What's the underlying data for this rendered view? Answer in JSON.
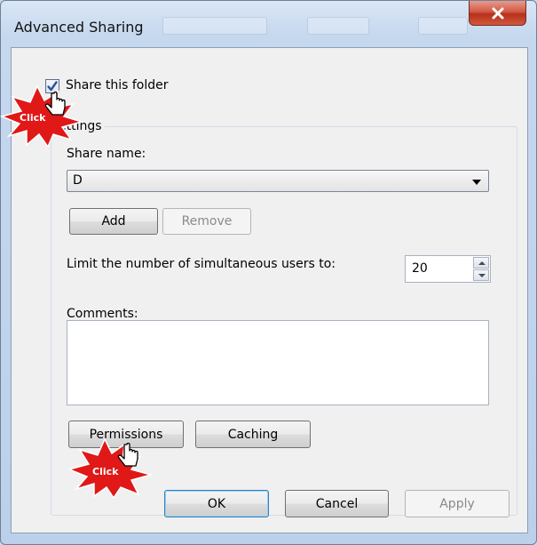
{
  "window": {
    "title": "Advanced Sharing"
  },
  "share": {
    "checkbox_label": "Share this folder",
    "checked": true
  },
  "settings": {
    "group_title": "ettings",
    "share_name_label": "Share name:",
    "share_name_value": "D",
    "add_label": "Add",
    "remove_label": "Remove",
    "limit_label": "Limit the number of simultaneous users to:",
    "limit_value": "20",
    "comments_label": "Comments:",
    "comments_value": "",
    "permissions_label": "Permissions",
    "caching_label": "Caching"
  },
  "footer": {
    "ok_label": "OK",
    "cancel_label": "Cancel",
    "apply_label": "Apply"
  },
  "annotations": {
    "click_label_1": "Click",
    "click_label_2": "Click",
    "burst_color": "#e01818"
  },
  "icons": {
    "close": "close-x-icon",
    "checkmark": "checkmark-icon",
    "combo_arrow": "dropdown-arrow-icon",
    "spin_up": "spin-up-icon",
    "spin_down": "spin-down-icon",
    "hand_cursor": "hand-cursor-icon"
  }
}
